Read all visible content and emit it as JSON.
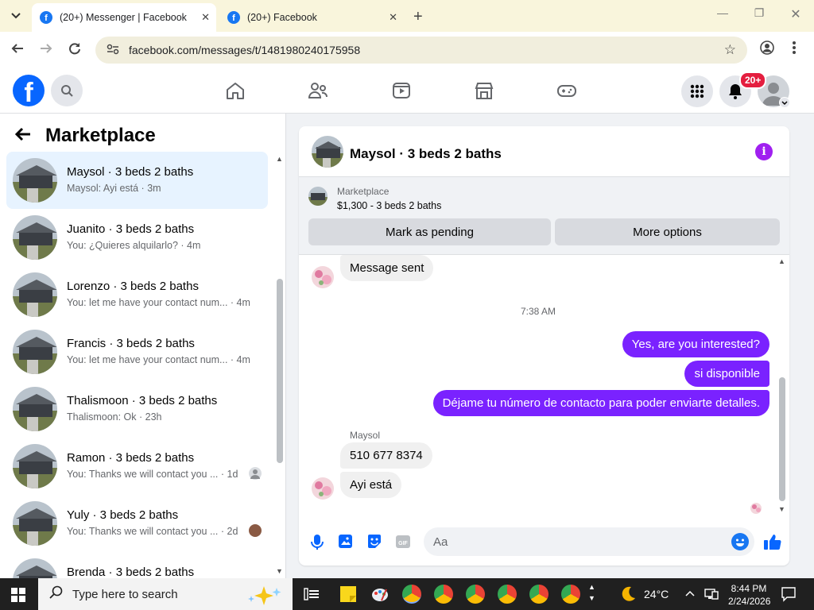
{
  "browser": {
    "tabs": [
      {
        "title": "(20+) Messenger | Facebook",
        "active": true
      },
      {
        "title": "(20+) Facebook",
        "active": false
      }
    ],
    "url": "facebook.com/messages/t/1481980240175958"
  },
  "fb": {
    "notification_badge": "20+"
  },
  "sidebar": {
    "title": "Marketplace",
    "conversations": [
      {
        "name": "Maysol · 3 beds 2 baths",
        "preview": "Maysol: Ayi está · 3m",
        "selected": true
      },
      {
        "name": "Juanito · 3 beds 2 baths",
        "preview": "You: ¿Quieres alquilarlo? · 4m"
      },
      {
        "name": "Lorenzo · 3 beds 2 baths",
        "preview": "You: let me have your contact num... · 4m"
      },
      {
        "name": "Francis · 3 beds 2 baths",
        "preview": "You: let me have your contact num... · 4m"
      },
      {
        "name": "Thalismoon · 3 beds 2 baths",
        "preview": "Thalismoon: Ok · 23h"
      },
      {
        "name": "Ramon · 3 beds 2 baths",
        "preview": "You: Thanks we will contact you ... · 1d"
      },
      {
        "name": "Yuly · 3 beds 2 baths",
        "preview": "You: Thanks we will contact you ... · 2d"
      },
      {
        "name": "Brenda · 3 beds 2 baths",
        "preview": ""
      }
    ]
  },
  "chat": {
    "title": "Maysol · 3 beds 2 baths",
    "listing": {
      "label": "Marketplace",
      "price_line": "$1,300 - 3 beds 2 baths",
      "mark_pending": "Mark as pending",
      "more_options": "More options"
    },
    "messages": [
      {
        "text": "Message sent",
        "dir": "in"
      },
      {
        "text": "7:38 AM",
        "dir": "time"
      },
      {
        "text": "Yes, are you interested?",
        "dir": "out"
      },
      {
        "text": "si disponible",
        "dir": "out"
      },
      {
        "text": "Déjame tu número de contacto para poder enviarte detalles.",
        "dir": "out"
      },
      {
        "text": "Maysol",
        "dir": "sender"
      },
      {
        "text": "510 677 8374",
        "dir": "in"
      },
      {
        "text": "Ayi está",
        "dir": "in"
      }
    ],
    "composer_placeholder": "Aa"
  },
  "taskbar": {
    "search_placeholder": "Type here to search",
    "temperature": "24°C",
    "time": "8:44 PM",
    "date": "2/24/2026"
  }
}
